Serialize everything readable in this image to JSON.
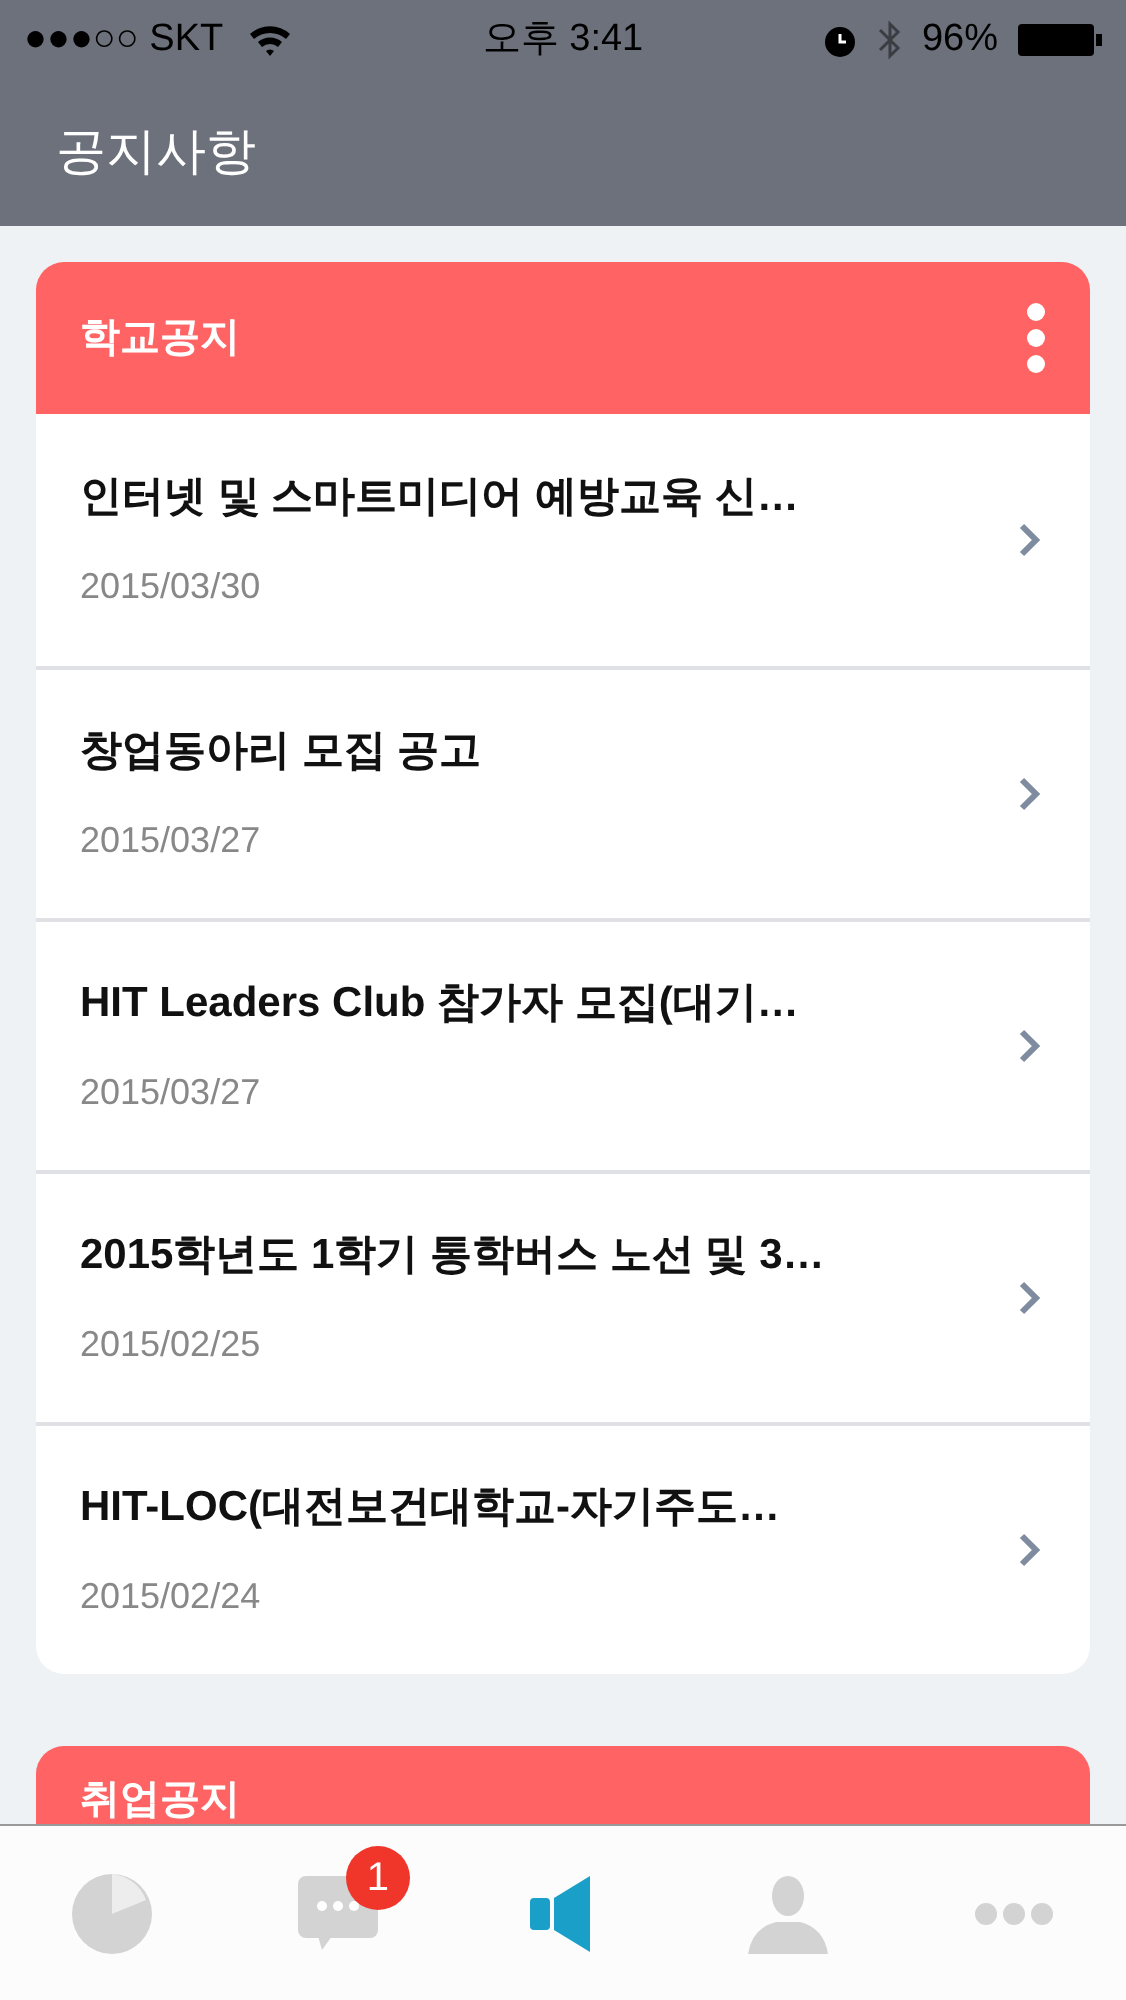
{
  "status_bar": {
    "carrier": "●●●○○ SKT",
    "time": "오후 3:41",
    "battery": "96%"
  },
  "nav": {
    "title": "공지사항"
  },
  "sections": [
    {
      "title": "학교공지",
      "items": [
        {
          "title": "인터넷 및 스마트미디어 예방교육 신…",
          "date": "2015/03/30"
        },
        {
          "title": "창업동아리 모집 공고",
          "date": "2015/03/27"
        },
        {
          "title": "HIT Leaders Club 참가자 모집(대기…",
          "date": "2015/03/27"
        },
        {
          "title": "2015학년도 1학기 통학버스 노선 및 3…",
          "date": "2015/02/25"
        },
        {
          "title": "HIT-LOC(대전보건대학교-자기주도…",
          "date": "2015/02/24"
        }
      ]
    },
    {
      "title": "취업공지"
    }
  ],
  "tab_bar": [
    {
      "kind": "chart",
      "selected": false
    },
    {
      "kind": "chat",
      "selected": false,
      "badge": "1"
    },
    {
      "kind": "notice",
      "selected": true
    },
    {
      "kind": "person",
      "selected": false
    },
    {
      "kind": "more",
      "selected": false
    }
  ]
}
